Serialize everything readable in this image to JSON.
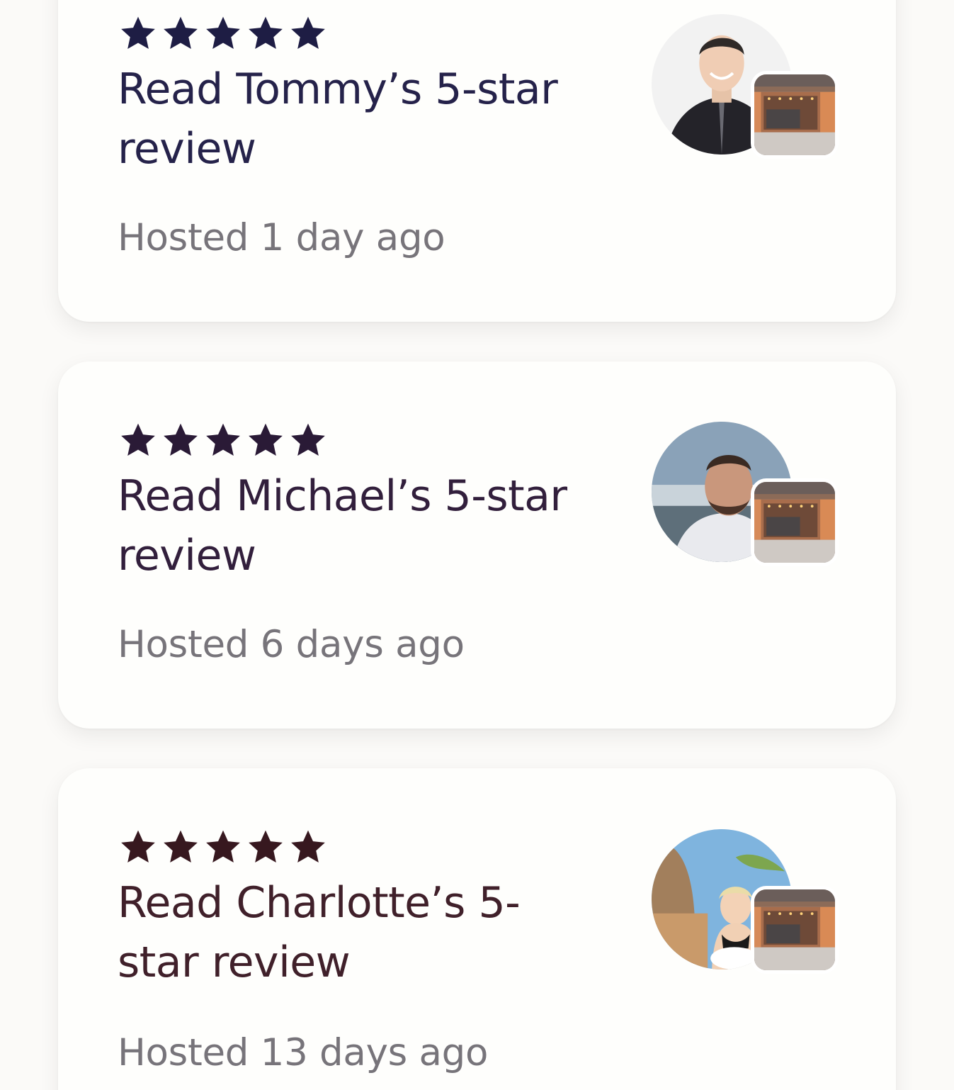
{
  "reviews": [
    {
      "stars": 5,
      "title": "Read Tommy’s 5-star review",
      "hosted": "Hosted 1 day ago",
      "avatar_icon": "guest-avatar-tommy",
      "listing_icon": "listing-thumbnail"
    },
    {
      "stars": 5,
      "title": "Read Michael’s 5-star review",
      "hosted": "Hosted 6 days ago",
      "avatar_icon": "guest-avatar-michael",
      "listing_icon": "listing-thumbnail"
    },
    {
      "stars": 5,
      "title": "Read Charlotte’s 5-star review",
      "hosted": "Hosted 13 days ago",
      "avatar_icon": "guest-avatar-charlotte",
      "listing_icon": "listing-thumbnail"
    }
  ],
  "colors": {
    "card_background": "#fefefc",
    "page_background": "#fbfaf8",
    "star_color": "#1e1a3a",
    "hosted_text": "#77747a"
  }
}
